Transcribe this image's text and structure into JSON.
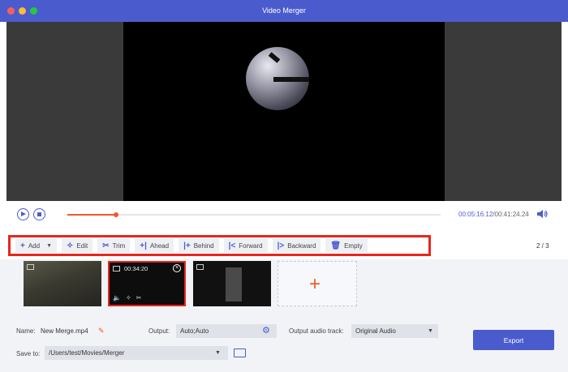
{
  "window": {
    "title": "Video Merger"
  },
  "player": {
    "current_time": "00:05:16.12",
    "total_time": "/00:41:24.24",
    "progress_fraction": 0.13
  },
  "toolbar": {
    "items": [
      {
        "label": "Add",
        "icon": "plus-icon"
      },
      {
        "label": "Edit",
        "icon": "magic-wand-icon"
      },
      {
        "label": "Trim",
        "icon": "scissors-icon"
      },
      {
        "label": "Ahead",
        "icon": "insert-ahead-icon"
      },
      {
        "label": "Behind",
        "icon": "insert-behind-icon"
      },
      {
        "label": "Forward",
        "icon": "move-forward-icon"
      },
      {
        "label": "Backward",
        "icon": "move-backward-icon"
      },
      {
        "label": "Empty",
        "icon": "trash-icon"
      }
    ],
    "page_current": "2",
    "page_total": "3"
  },
  "clips": [
    {
      "duration": ""
    },
    {
      "duration": "00:34:20"
    },
    {
      "duration": ""
    }
  ],
  "output": {
    "name_label": "Name:",
    "name_value": "New Merge.mp4",
    "output_label": "Output:",
    "output_value": "Auto;Auto",
    "audio_label": "Output audio track:",
    "audio_value": "Original Audio",
    "save_label": "Save to:",
    "save_value": "/Users/test/Movies/Merger",
    "export_label": "Export"
  },
  "colors": {
    "accent": "#4a5ccd",
    "highlight": "#e8251c",
    "progress": "#f05a28"
  }
}
